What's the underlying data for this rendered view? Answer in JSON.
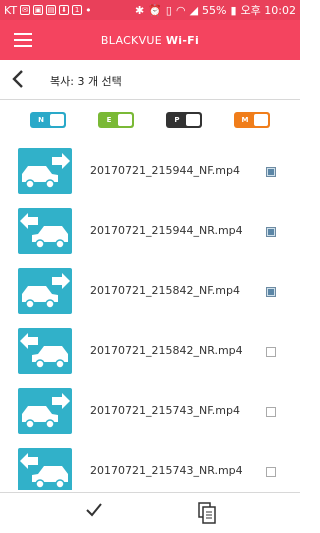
{
  "status_bar": {
    "carrier": "KT",
    "battery": "55%",
    "time": "오후 10:02"
  },
  "app_bar": {
    "title_prefix": "BLACKVUE",
    "title_suffix": "Wi-Fi"
  },
  "sub_bar": {
    "title": "복사: 3 개 선택"
  },
  "filters": [
    {
      "label": "N",
      "color": "#2aa9c9"
    },
    {
      "label": "E",
      "color": "#7ab936"
    },
    {
      "label": "P",
      "color": "#333333"
    },
    {
      "label": "M",
      "color": "#f07d1a"
    }
  ],
  "files": [
    {
      "name": "20170721_215944_NF.mp4",
      "direction": "front",
      "checked": true
    },
    {
      "name": "20170721_215944_NR.mp4",
      "direction": "rear",
      "checked": true
    },
    {
      "name": "20170721_215842_NF.mp4",
      "direction": "front",
      "checked": true
    },
    {
      "name": "20170721_215842_NR.mp4",
      "direction": "rear",
      "checked": false
    },
    {
      "name": "20170721_215743_NF.mp4",
      "direction": "front",
      "checked": false
    },
    {
      "name": "20170721_215743_NR.mp4",
      "direction": "rear",
      "checked": false
    }
  ],
  "icons": {
    "menu": "hamburger-menu-icon",
    "back": "back-arrow-icon",
    "confirm": "checkmark-icon",
    "copy": "copy-icon"
  }
}
